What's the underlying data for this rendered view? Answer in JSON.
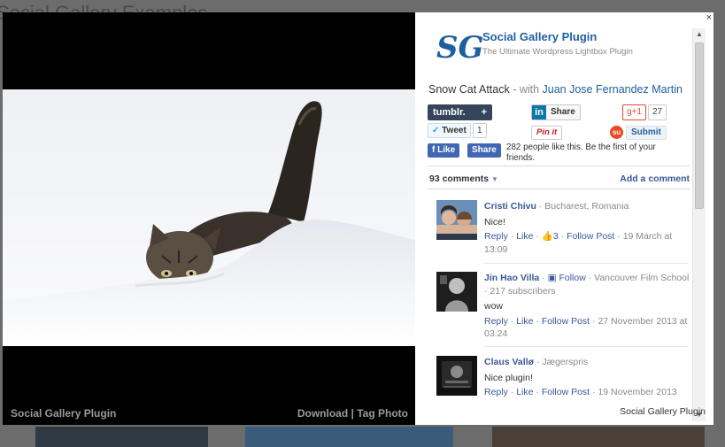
{
  "background": {
    "page_title": "Social Gallery Examples"
  },
  "lightbox": {
    "close_label": "×",
    "photo_caption": "Social Gallery Plugin",
    "photo_links": {
      "download": "Download",
      "separator": "|",
      "tag": "Tag Photo"
    }
  },
  "panel": {
    "brand": {
      "logo": "SG",
      "title": "Social Gallery Plugin",
      "subtitle": "The Ultimate Wordpress Lightbox Plugin"
    },
    "photo_title": {
      "name": "Snow Cat Attack",
      "with_text": " - with ",
      "author": "Juan Jose Fernandez Martin"
    },
    "share": {
      "tumblr_label": "tumblr.",
      "tumblr_plus": "+",
      "linkedin_icon": "in",
      "linkedin_label": "Share",
      "gplus_label": "g+1",
      "gplus_count": "27",
      "tweet_label": "Tweet",
      "tweet_count": "1",
      "pinit_label": "Pin it",
      "stumble_icon": "su",
      "stumble_label": "Submit",
      "fb_like": "Like",
      "fb_share": "Share",
      "fb_text": "282 people like this. Be the first of your friends."
    },
    "comments": {
      "count_label": "93 comments",
      "add_label": "Add a comment",
      "items": [
        {
          "name": "Cristi Chivu",
          "meta": "· Bucharest, Romania",
          "follow": "",
          "subscribers": "",
          "text": "Nice!",
          "reply": "Reply",
          "like": "Like",
          "like_count": "3",
          "follow_post": "Follow Post",
          "date": "19 March at 13:09"
        },
        {
          "name": "Jin Hao Villa",
          "meta": "· Vancouver Film School",
          "follow": "Follow",
          "subscribers": "· 217 subscribers",
          "text": "wow",
          "reply": "Reply",
          "like": "Like",
          "like_count": "",
          "follow_post": "Follow Post",
          "date": "27 November 2013 at 03:24"
        },
        {
          "name": "Claus Vallø",
          "meta": "· Jægerspris",
          "follow": "",
          "subscribers": "",
          "text": "Nice plugin!",
          "reply": "Reply",
          "like": "Like",
          "like_count": "",
          "follow_post": "Follow Post",
          "date": "19 November 2013"
        }
      ]
    },
    "footer": "Social Gallery Plugin"
  }
}
